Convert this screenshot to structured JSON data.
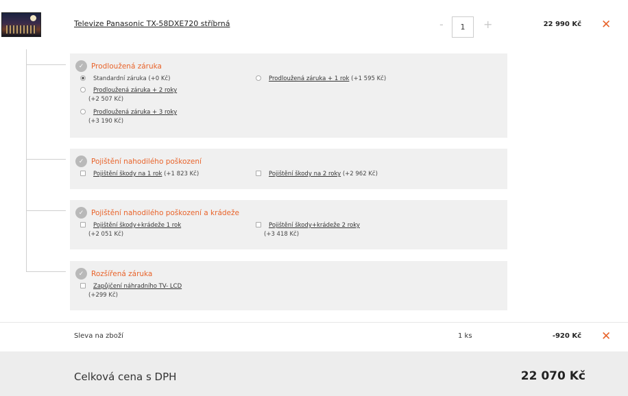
{
  "product": {
    "name": "Televize Panasonic TX-58DXE720 stříbrná",
    "qty_minus": "-",
    "qty": "1",
    "qty_plus": "+",
    "price": "22 990 Kč",
    "remove": "✕"
  },
  "services": [
    {
      "title": "Prodloužená záruka",
      "options": [
        {
          "label": "Standardní záruka",
          "price": "(+0 Kč)",
          "type": "radio",
          "checked": true,
          "link": false
        },
        {
          "label": "Prodloužená záruka + 1 rok",
          "price": "(+1 595 Kč)",
          "type": "radio",
          "checked": false,
          "link": true
        },
        {
          "label": "Prodloužená záruka + 2 roky",
          "price": "(+2 507 Kč)",
          "type": "radio",
          "checked": false,
          "link": true
        },
        {
          "label": "Prodloužená záruka + 3 roky",
          "price": "(+3 190 Kč)",
          "type": "radio",
          "checked": false,
          "link": true
        }
      ]
    },
    {
      "title": "Pojištění nahodilého poškození",
      "options": [
        {
          "label": "Pojištění škody na 1 rok",
          "price": "(+1 823 Kč)",
          "type": "checkbox",
          "checked": false,
          "link": true
        },
        {
          "label": "Pojištění škody na 2 roky",
          "price": "(+2 962 Kč)",
          "type": "checkbox",
          "checked": false,
          "link": true
        }
      ]
    },
    {
      "title": "Pojištění nahodilého poškození a krádeže",
      "options": [
        {
          "label": "Pojištění škody+krádeže 1 rok",
          "price": "(+2 051 Kč)",
          "type": "checkbox",
          "checked": false,
          "link": true
        },
        {
          "label": "Pojištění škody+krádeže 2 roky",
          "price": "(+3 418 Kč)",
          "type": "checkbox",
          "checked": false,
          "link": true
        }
      ]
    },
    {
      "title": "Rozšířená záruka",
      "options": [
        {
          "label": "Zapůjčení náhradního TV- LCD",
          "price": "(+299 Kč)",
          "type": "checkbox",
          "checked": false,
          "link": true
        }
      ]
    }
  ],
  "discount": {
    "label": "Sleva na zboží",
    "qty": "1 ks",
    "price": "-920 Kč",
    "remove": "✕"
  },
  "total": {
    "label": "Celková cena s DPH",
    "value": "22 070 Kč"
  },
  "colors": {
    "accent": "#e8632a",
    "panel": "#f0f0f0",
    "total_bar": "#ededed"
  }
}
